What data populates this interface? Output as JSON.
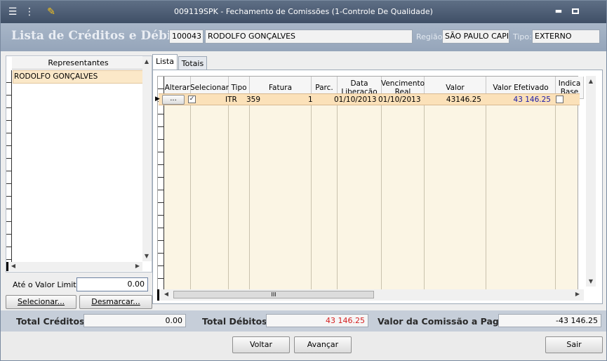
{
  "window": {
    "title": "009119SPK - Fechamento de Comissões (1-Controle De Qualidade)",
    "minimize_label": "▬",
    "maximize_label": "■"
  },
  "header": {
    "title": "Lista de Créditos e Débito :",
    "code": "100043",
    "name": "RODOLFO GONÇALVES",
    "region_label": "Região:",
    "region_value": "SÃO PAULO CAPIT.",
    "type_label": "Tipo:",
    "type_value": "EXTERNO"
  },
  "left_panel": {
    "column_header": "Representantes",
    "items": [
      "RODOLFO GONÇALVES"
    ],
    "limit_label": "Até o Valor Limite :",
    "limit_value": "0.00",
    "select_button": "Selecionar...",
    "unselect_button": "Desmarcar..."
  },
  "tabs": [
    "Lista",
    "Totais"
  ],
  "grid": {
    "columns": [
      "Alterar",
      "Selecionar",
      "Tipo",
      "Fatura",
      "Parc.",
      "Data Liberação",
      "Vencimento Real",
      "Valor",
      "Valor Efetivado",
      "Indica Base"
    ],
    "row": {
      "alterar": "...",
      "selecionar": true,
      "tipo": "ITR",
      "fatura": "359",
      "parc": "1",
      "data_liberacao": "01/10/2013",
      "vencimento_real": "01/10/2013",
      "valor": "43146.25",
      "valor_efetivado": "43 146.25",
      "indica_base": false
    },
    "hscroll_label": "III"
  },
  "footer": {
    "total_creditos_label": "Total Créditos:",
    "total_creditos_value": "0.00",
    "total_debitos_label": "Total Débitos:",
    "total_debitos_value": "43 146.25",
    "comissao_label": "Valor da Comissão a Pagar:",
    "comissao_value": "-43 146.25"
  },
  "buttons": {
    "voltar": "Voltar",
    "avancar": "Avançar",
    "sair": "Sair"
  },
  "colors": {
    "debit_red": "#d42020",
    "effective_blue": "#1a1aa8"
  }
}
